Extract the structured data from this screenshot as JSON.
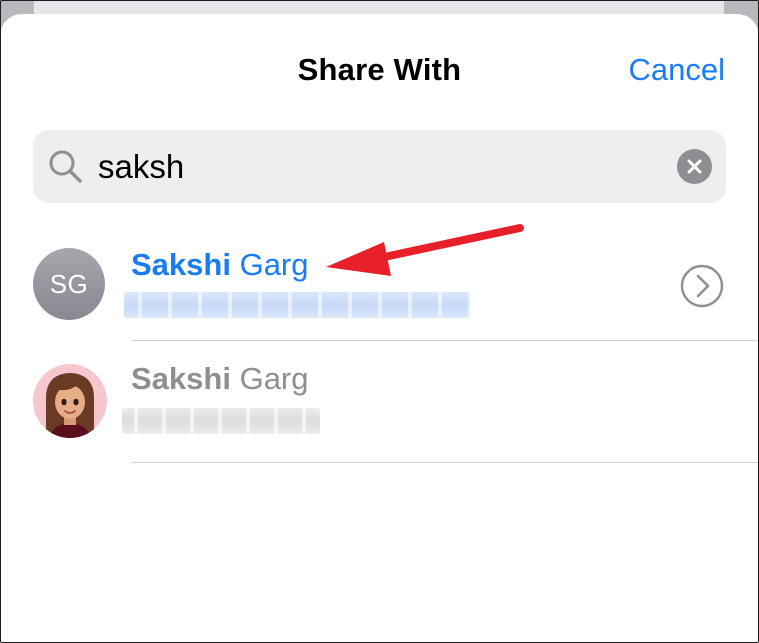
{
  "header": {
    "title": "Share With",
    "cancel_label": "Cancel"
  },
  "search": {
    "value": "saksh",
    "icon": "search-icon",
    "clear_icon": "clear-icon"
  },
  "contacts": [
    {
      "initials": "SG",
      "first_name": "Sakshi",
      "last_name": "Garg",
      "detail_redacted": true,
      "highlighted": true,
      "accessory": "info-chevron-icon"
    },
    {
      "avatar": "memoji-avatar",
      "first_name": "Sakshi",
      "last_name": "Garg",
      "detail_redacted": true,
      "highlighted": false
    }
  ],
  "colors": {
    "accent": "#1a7cf5",
    "secondary_text": "#8e8e93",
    "annotation": "#e8202a"
  }
}
